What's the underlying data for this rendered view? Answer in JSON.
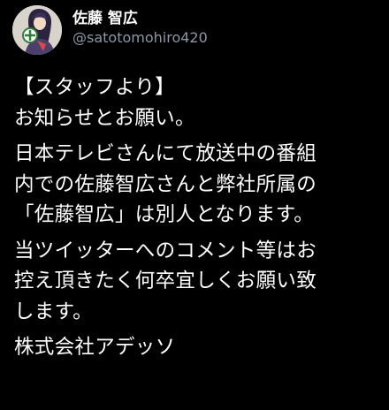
{
  "tweet": {
    "author": {
      "display_name": "佐藤 智広",
      "handle": "@satotomohiro420",
      "avatar_icon": "avatar-illustration-icon"
    },
    "paragraphs": [
      "【スタッフより】\nお知らせとお願い。",
      "日本テレビさんにて放送中の番組\n内での佐藤智広さんと弊社所属の\n「佐藤智広」は別人となります。",
      "当ツイッターへのコメント等はお\n控え頂きたく何卒宜しくお願い致\nします。",
      "株式会社アデッソ"
    ]
  },
  "colors": {
    "background": "#000000",
    "text_primary": "#ffffff",
    "text_secondary": "#8b98a5"
  }
}
